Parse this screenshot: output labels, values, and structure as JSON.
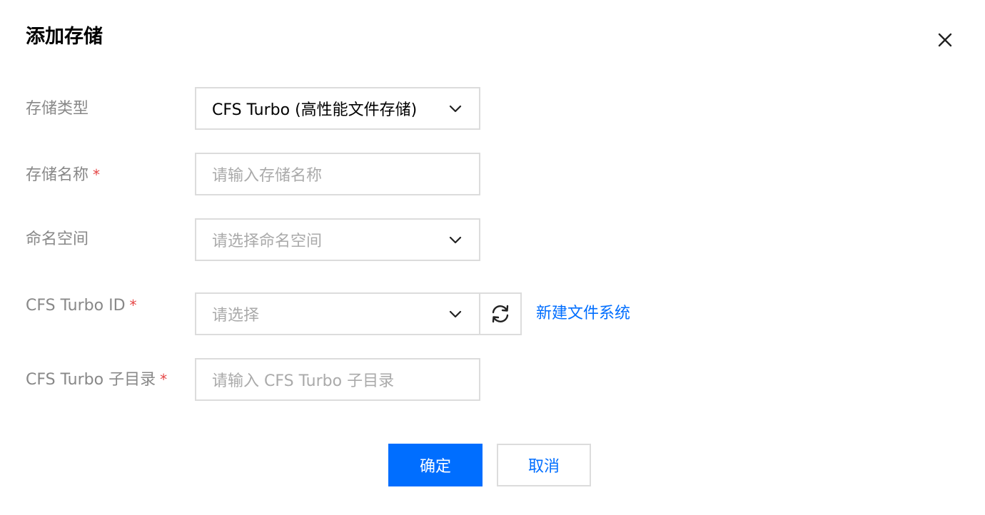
{
  "dialog": {
    "title": "添加存储",
    "close_icon": "close-icon"
  },
  "form": {
    "storage_type": {
      "label": "存储类型",
      "value": "CFS Turbo (高性能文件存储)"
    },
    "storage_name": {
      "label": "存储名称",
      "required_mark": "*",
      "placeholder": "请输入存储名称"
    },
    "namespace": {
      "label": "命名空间",
      "placeholder": "请选择命名空间"
    },
    "cfs_turbo_id": {
      "label": "CFS Turbo ID",
      "required_mark": "*",
      "placeholder": "请选择",
      "refresh_icon": "refresh-icon",
      "create_link": "新建文件系统"
    },
    "cfs_turbo_subdir": {
      "label": "CFS Turbo 子目录",
      "required_mark": "*",
      "placeholder": "请输入 CFS Turbo 子目录"
    }
  },
  "footer": {
    "confirm_label": "确定",
    "cancel_label": "取消"
  },
  "colors": {
    "primary": "#006eff",
    "required": "#e54545",
    "label": "#888888",
    "border": "#dcdcdc"
  }
}
